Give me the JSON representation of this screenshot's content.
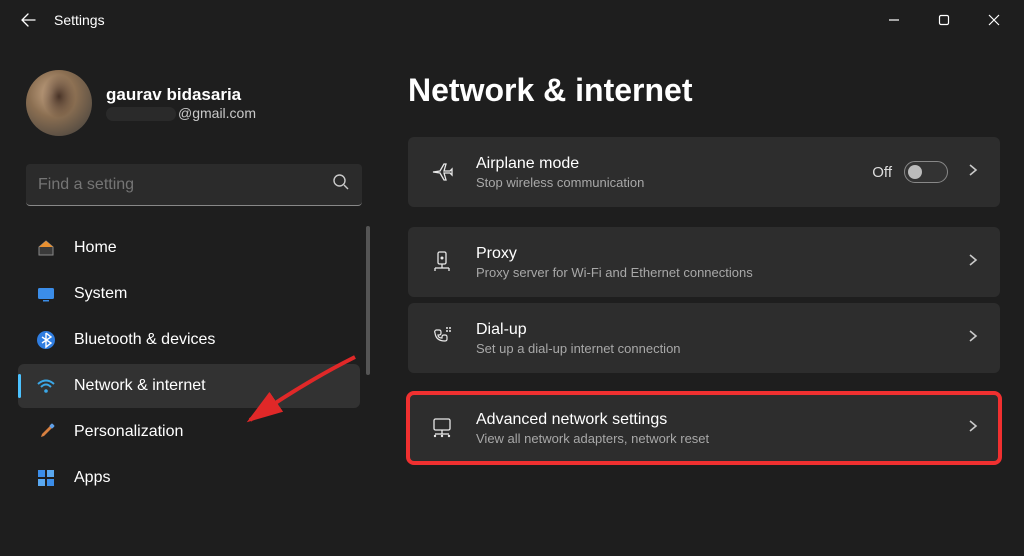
{
  "titlebar": {
    "title": "Settings"
  },
  "profile": {
    "name": "gaurav bidasaria",
    "email_suffix": "@gmail.com"
  },
  "search": {
    "placeholder": "Find a setting"
  },
  "sidebar": {
    "items": [
      {
        "label": "Home"
      },
      {
        "label": "System"
      },
      {
        "label": "Bluetooth & devices"
      },
      {
        "label": "Network & internet"
      },
      {
        "label": "Personalization"
      },
      {
        "label": "Apps"
      }
    ]
  },
  "page": {
    "title": "Network & internet"
  },
  "cards": {
    "airplane": {
      "title": "Airplane mode",
      "sub": "Stop wireless communication",
      "toggle_label": "Off"
    },
    "proxy": {
      "title": "Proxy",
      "sub": "Proxy server for Wi-Fi and Ethernet connections"
    },
    "dialup": {
      "title": "Dial-up",
      "sub": "Set up a dial-up internet connection"
    },
    "advanced": {
      "title": "Advanced network settings",
      "sub": "View all network adapters, network reset"
    }
  }
}
